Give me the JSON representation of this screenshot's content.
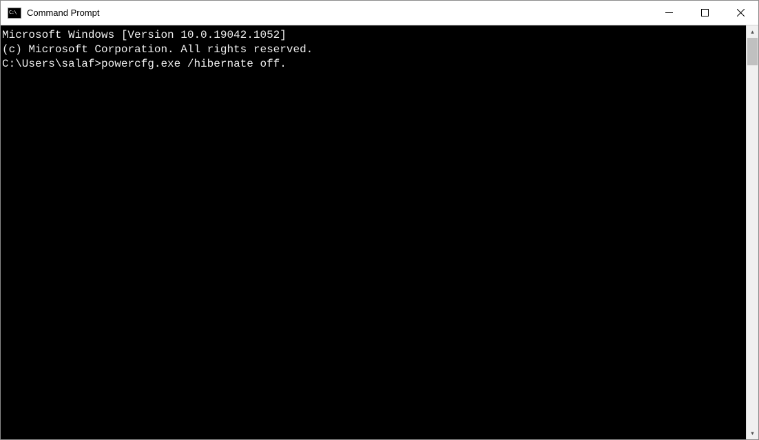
{
  "window": {
    "title": "Command Prompt"
  },
  "terminal": {
    "line1": "Microsoft Windows [Version 10.0.19042.1052]",
    "line2": "(c) Microsoft Corporation. All rights reserved.",
    "blank": "",
    "prompt": "C:\\Users\\salaf>",
    "command": "powercfg.exe /hibernate off."
  }
}
